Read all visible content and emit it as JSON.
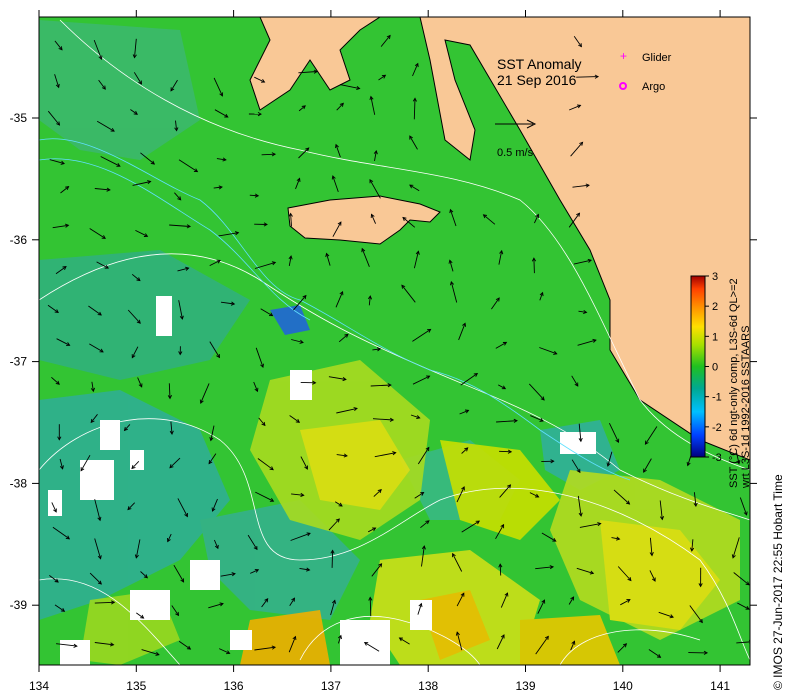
{
  "title": {
    "line1": "SST Anomaly",
    "line2": "21 Sep 2016"
  },
  "legend": [
    {
      "label": "Glider",
      "symbol": "plus",
      "color": "#ff00ff"
    },
    {
      "label": "Argo",
      "symbol": "circle",
      "color": "#ff00ff"
    }
  ],
  "scale_arrow": {
    "label": "0.5 m/s",
    "speed": 0.5
  },
  "x_ticks": [
    "134",
    "135",
    "136",
    "137",
    "138",
    "139",
    "140",
    "141"
  ],
  "y_ticks": [
    "-35",
    "-36",
    "-37",
    "-38",
    "-39"
  ],
  "colorbar": {
    "ticks": [
      "3",
      "2",
      "1",
      "0",
      "-1",
      "-2",
      "-3"
    ],
    "title_line1": "SST (°C) 6d ngt-only comp, L3S-6d QL>=2",
    "title_line2": "wrt L3S-1d 1992-2016 SSTAARS",
    "colors": [
      "#000080",
      "#0040ff",
      "#00c0ff",
      "#00c060",
      "#40c020",
      "#c8e000",
      "#ffe000",
      "#ff9000",
      "#ff4000",
      "#a00000"
    ]
  },
  "credit": "© IMOS 27-Jun-2017 22:55 Hobart Time",
  "colors": {
    "land": "#f9c896",
    "ocean_base": "#33c433",
    "contour": "#ffffff",
    "vector": "#000000"
  }
}
